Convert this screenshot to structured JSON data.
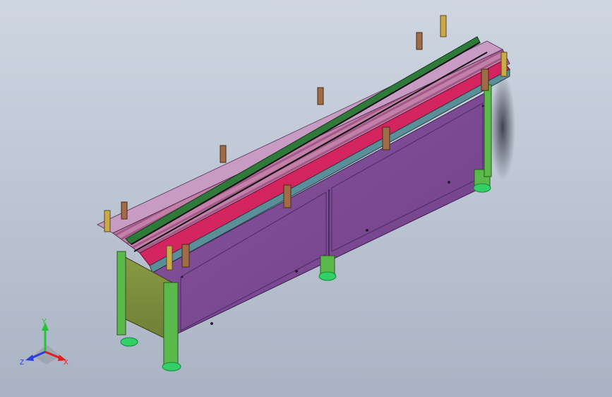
{
  "viewport": {
    "model": "roller-conveyor-assembly",
    "colors": {
      "background_top": "#cfd6e2",
      "background_bottom": "#a9b3c3",
      "side_panel": "#7e4a94",
      "end_panel": "#7f8f3f",
      "legs": "#5bb84a",
      "feet": "#33d068",
      "top_rail": "#d7266b",
      "guide_rail": "#2f7a3a",
      "rollers": "#c97aa7",
      "side_frame": "#c4a0c0",
      "brackets": "#a0704a",
      "mounting_posts": "#c9a94a"
    }
  },
  "triad": {
    "y_label": "Y",
    "x_label": "X",
    "z_label": "Z",
    "y_color": "#27c33c",
    "x_color": "#e02020",
    "z_color": "#2a3fe0"
  }
}
